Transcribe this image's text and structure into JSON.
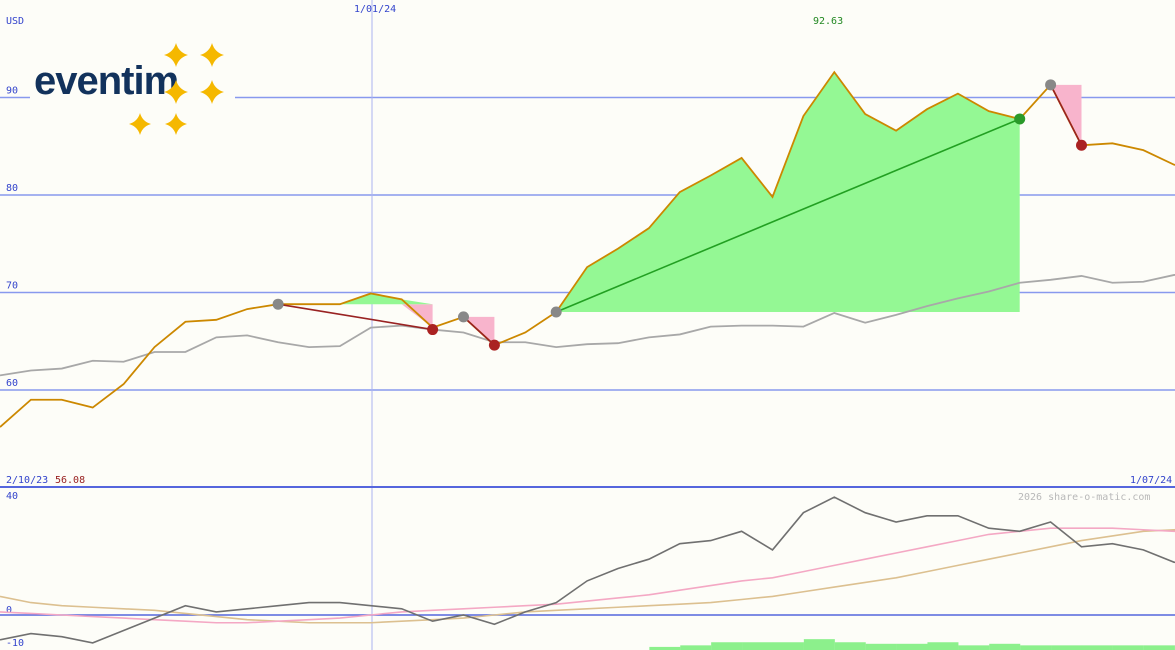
{
  "chart_data": [
    {
      "type": "line",
      "panel": "price",
      "ylabel": "USD",
      "x_tick_labels": [
        "1/01/24"
      ],
      "x_range_labels": {
        "start": "2/10/23",
        "end": "1/07/24"
      },
      "start_value_label": "56.08",
      "peak_label": "92.63",
      "y_ticks": [
        60,
        70,
        80,
        90
      ],
      "ylim": [
        56,
        102
      ],
      "weeks": 48,
      "series": [
        {
          "name": "",
          "color": "#cc8800",
          "x": [
            0,
            1,
            2,
            3,
            4,
            5,
            6,
            7,
            8,
            9,
            10,
            11,
            12,
            13,
            14,
            15,
            16,
            17,
            18,
            19,
            20,
            21,
            22,
            23,
            24,
            25,
            26,
            27,
            28,
            29,
            30,
            31,
            32,
            33,
            34,
            35,
            36,
            37,
            38,
            39
          ],
          "values": [
            56.2,
            59.0,
            59.0,
            58.2,
            60.6,
            64.4,
            67.0,
            67.2,
            68.3,
            68.8,
            68.8,
            68.8,
            69.9,
            69.3,
            66.4,
            67.5,
            64.6,
            65.9,
            68.0,
            72.6,
            74.5,
            76.6,
            80.3,
            82.0,
            83.8,
            79.8,
            88.1,
            92.6,
            88.3,
            86.6,
            88.8,
            90.4,
            88.6,
            87.8,
            91.3,
            85.1,
            85.3,
            84.6,
            83.1,
            83.0
          ]
        },
        {
          "name": "",
          "color": "#a8a8a8",
          "x": [
            0,
            1,
            2,
            3,
            4,
            5,
            6,
            7,
            8,
            9,
            10,
            11,
            12,
            13,
            14,
            15,
            16,
            17,
            18,
            19,
            20,
            21,
            22,
            23,
            24,
            25,
            26,
            27,
            28,
            29,
            30,
            31,
            32,
            33,
            34,
            35,
            36,
            37,
            38,
            39
          ],
          "values": [
            61.5,
            62.0,
            62.2,
            63.0,
            62.9,
            63.9,
            63.9,
            65.4,
            65.6,
            64.9,
            64.4,
            64.5,
            66.4,
            66.6,
            66.2,
            65.9,
            64.9,
            64.9,
            64.4,
            64.7,
            64.8,
            65.4,
            65.7,
            66.5,
            66.6,
            66.6,
            66.5,
            67.9,
            66.9,
            67.7,
            68.6,
            69.4,
            70.1,
            71.0,
            71.3,
            71.7,
            71.0,
            71.1,
            71.8,
            71.9
          ]
        }
      ],
      "trades": [
        {
          "entry_x": 9,
          "entry_y": 68.8,
          "exit_x": 14,
          "exit_y": 66.2,
          "result": "loss"
        },
        {
          "entry_x": 15,
          "entry_y": 67.5,
          "exit_x": 16,
          "exit_y": 64.6,
          "result": "loss"
        },
        {
          "entry_x": 18,
          "entry_y": 68.0,
          "exit_x": 33,
          "exit_y": 87.8,
          "result": "gain"
        },
        {
          "entry_x": 34,
          "entry_y": 91.3,
          "exit_x": 35,
          "exit_y": 85.1,
          "result": "loss"
        }
      ],
      "colors": {
        "gain_fill": "#94f894",
        "loss_fill": "#f8b4cc",
        "gain_line": "#22a022",
        "loss_line": "#992222",
        "grid": "#8899ee"
      }
    },
    {
      "type": "line",
      "panel": "oscillator",
      "y_ticks": [
        40,
        0,
        -10
      ],
      "ylim": [
        -12,
        42
      ],
      "series": [
        {
          "name": "",
          "color": "#707070",
          "values": [
            -8,
            -6,
            -7,
            -9,
            -5,
            -1,
            3,
            1,
            2,
            3,
            4,
            4,
            3,
            2,
            -2,
            0,
            -3,
            1,
            4,
            11,
            15,
            18,
            23,
            24,
            27,
            21,
            33,
            38,
            33,
            30,
            32,
            32,
            28,
            27,
            30,
            22,
            23,
            21,
            17,
            18
          ]
        },
        {
          "name": "",
          "color": "#f4a8c4",
          "values": [
            1,
            0.5,
            0,
            -0.5,
            -1,
            -1.5,
            -2,
            -2.5,
            -2.5,
            -2,
            -1.5,
            -1,
            0,
            1,
            1.5,
            2,
            2.5,
            3,
            3.5,
            4.5,
            5.5,
            6.5,
            8,
            9.5,
            11,
            12,
            14,
            16,
            18,
            20,
            22,
            24,
            26,
            27,
            28,
            28,
            28,
            27.5,
            27,
            26.5
          ]
        },
        {
          "name": "",
          "color": "#dcc090",
          "values": [
            6,
            4,
            3,
            2.5,
            2,
            1.5,
            0.5,
            -0.5,
            -1.5,
            -2,
            -2.5,
            -2.5,
            -2.5,
            -2,
            -1.5,
            -1,
            0,
            1,
            1.5,
            2,
            2.5,
            3,
            3.5,
            4,
            5,
            6,
            7.5,
            9,
            10.5,
            12,
            14,
            16,
            18,
            20,
            22,
            24,
            25.5,
            27,
            27.5,
            28
          ]
        }
      ],
      "volume_bars": [
        {
          "x": 21.5,
          "value": 1.0
        },
        {
          "x": 22.5,
          "value": 1.5
        },
        {
          "x": 23.5,
          "value": 2.5
        },
        {
          "x": 24.5,
          "value": 2.5
        },
        {
          "x": 25.5,
          "value": 2.5
        },
        {
          "x": 26.5,
          "value": 3.5
        },
        {
          "x": 27.5,
          "value": 2.5
        },
        {
          "x": 28.5,
          "value": 2.0
        },
        {
          "x": 29.5,
          "value": 2.0
        },
        {
          "x": 30.5,
          "value": 2.5
        },
        {
          "x": 31.5,
          "value": 1.5
        },
        {
          "x": 32.5,
          "value": 2.0
        },
        {
          "x": 33.5,
          "value": 1.5
        },
        {
          "x": 34.5,
          "value": 1.5
        },
        {
          "x": 35.5,
          "value": 1.5
        },
        {
          "x": 36.5,
          "value": 1.5
        },
        {
          "x": 37.5,
          "value": 1.5
        },
        {
          "x": 38.5,
          "value": 1.5
        }
      ]
    }
  ],
  "logo": {
    "text": "eventim",
    "star_color": "#f5b800"
  },
  "copyright": "2026 share-o-matic.com"
}
